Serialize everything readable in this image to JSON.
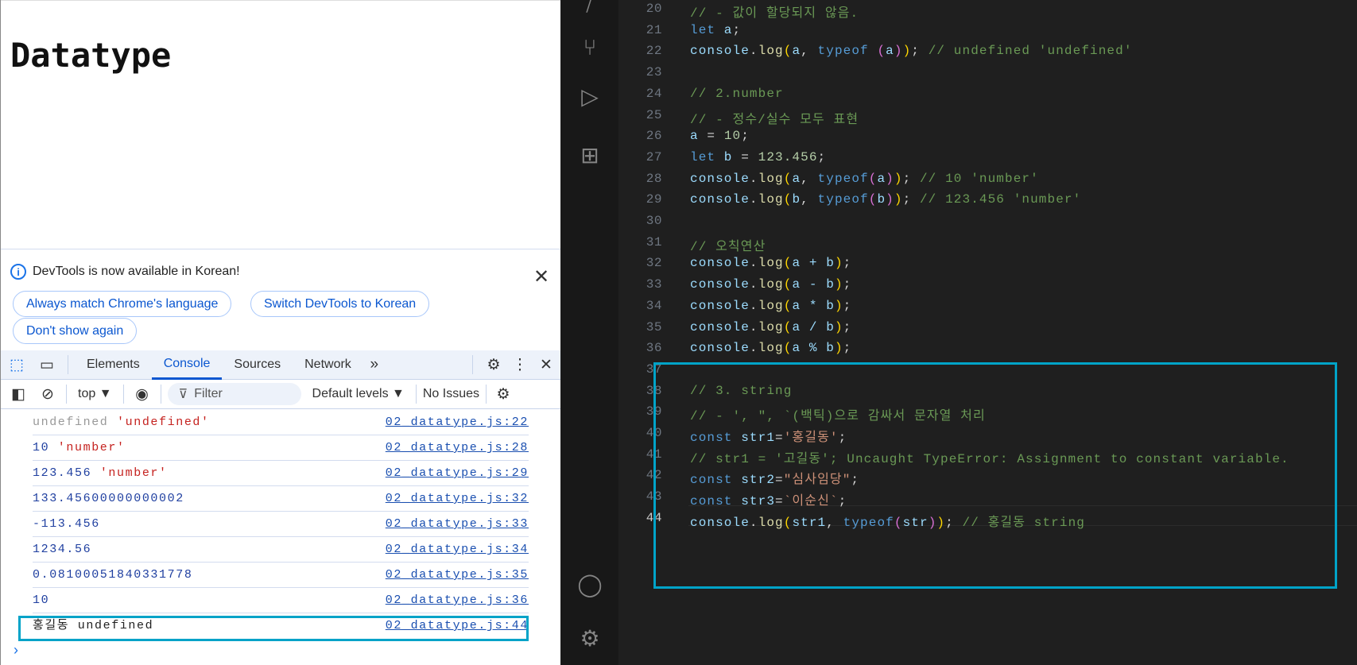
{
  "page": {
    "heading": "Datatype"
  },
  "infobar": {
    "message": "DevTools is now available in Korean!",
    "buttons": [
      "Always match Chrome's language",
      "Switch DevTools to Korean",
      "Don't show again"
    ]
  },
  "devtools": {
    "tabs": [
      "Elements",
      "Console",
      "Sources",
      "Network"
    ],
    "active_tab": "Console",
    "more": "»",
    "toolbar": {
      "context": "top ▼",
      "filter_placeholder": "Filter",
      "levels": "Default levels ▼",
      "issues": "No Issues"
    }
  },
  "console": [
    {
      "parts": [
        [
          "undefined",
          "gray"
        ],
        [
          " 'undefined'",
          "red"
        ]
      ],
      "source": "02_datatype.js:22"
    },
    {
      "parts": [
        [
          "10",
          ""
        ],
        [
          " 'number'",
          "red"
        ]
      ],
      "source": "02_datatype.js:28"
    },
    {
      "parts": [
        [
          "123.456",
          ""
        ],
        [
          " 'number'",
          "red"
        ]
      ],
      "source": "02_datatype.js:29"
    },
    {
      "parts": [
        [
          "133.45600000000002",
          ""
        ]
      ],
      "source": "02_datatype.js:32"
    },
    {
      "parts": [
        [
          "-113.456",
          ""
        ]
      ],
      "source": "02_datatype.js:33"
    },
    {
      "parts": [
        [
          "1234.56",
          ""
        ]
      ],
      "source": "02_datatype.js:34"
    },
    {
      "parts": [
        [
          "0.08100051840331778",
          ""
        ]
      ],
      "source": "02_datatype.js:35"
    },
    {
      "parts": [
        [
          "10",
          ""
        ]
      ],
      "source": "02_datatype.js:36"
    },
    {
      "parts": [
        [
          "홍길동 undefined",
          "dark"
        ]
      ],
      "source": "02_datatype.js:44",
      "highlighted": true
    }
  ],
  "console_prompt": "›",
  "highlight_color": "#00a3c8",
  "editor": {
    "current_line": 44,
    "lines": [
      {
        "n": 20,
        "t": [
          [
            "// - 값이 할당되지 않음.",
            "cm"
          ]
        ]
      },
      {
        "n": 21,
        "t": [
          [
            "let",
            "kw"
          ],
          [
            " a",
            ""
          ],
          [
            ";",
            "pl"
          ]
        ]
      },
      {
        "n": 22,
        "t": [
          [
            "console",
            "vr"
          ],
          [
            ".",
            "pl"
          ],
          [
            "log",
            "fn"
          ],
          [
            "(",
            "p1"
          ],
          [
            "a",
            "vr"
          ],
          [
            ", ",
            "pl"
          ],
          [
            "typeof",
            "kw"
          ],
          [
            " ",
            "pl"
          ],
          [
            "(",
            "p2"
          ],
          [
            "a",
            "vr"
          ],
          [
            ")",
            "p2"
          ],
          [
            ")",
            "p1"
          ],
          [
            "; ",
            "pl"
          ],
          [
            "// undefined 'undefined'",
            "cm"
          ]
        ]
      },
      {
        "n": 23,
        "t": []
      },
      {
        "n": 24,
        "t": [
          [
            "// 2.number",
            "cm"
          ]
        ]
      },
      {
        "n": 25,
        "t": [
          [
            "// - 정수/실수 모두 표현",
            "cm"
          ]
        ]
      },
      {
        "n": 26,
        "t": [
          [
            "a",
            "vr"
          ],
          [
            " = ",
            "pl"
          ],
          [
            "10",
            "nm"
          ],
          [
            ";",
            "pl"
          ]
        ]
      },
      {
        "n": 27,
        "t": [
          [
            "let",
            "kw"
          ],
          [
            " b",
            "vr"
          ],
          [
            " = ",
            "pl"
          ],
          [
            "123.456",
            "nm"
          ],
          [
            ";",
            "pl"
          ]
        ]
      },
      {
        "n": 28,
        "t": [
          [
            "console",
            "vr"
          ],
          [
            ".",
            "pl"
          ],
          [
            "log",
            "fn"
          ],
          [
            "(",
            "p1"
          ],
          [
            "a",
            "vr"
          ],
          [
            ", ",
            "pl"
          ],
          [
            "typeof",
            "kw"
          ],
          [
            "(",
            "p2"
          ],
          [
            "a",
            "vr"
          ],
          [
            ")",
            "p2"
          ],
          [
            ")",
            "p1"
          ],
          [
            "; ",
            "pl"
          ],
          [
            "// 10 'number'",
            "cm"
          ]
        ]
      },
      {
        "n": 29,
        "t": [
          [
            "console",
            "vr"
          ],
          [
            ".",
            "pl"
          ],
          [
            "log",
            "fn"
          ],
          [
            "(",
            "p1"
          ],
          [
            "b",
            "vr"
          ],
          [
            ", ",
            "pl"
          ],
          [
            "typeof",
            "kw"
          ],
          [
            "(",
            "p2"
          ],
          [
            "b",
            "vr"
          ],
          [
            ")",
            "p2"
          ],
          [
            ")",
            "p1"
          ],
          [
            "; ",
            "pl"
          ],
          [
            "// 123.456 'number'",
            "cm"
          ]
        ]
      },
      {
        "n": 30,
        "t": []
      },
      {
        "n": 31,
        "t": [
          [
            "// 오칙연산",
            "cm"
          ]
        ]
      },
      {
        "n": 32,
        "t": [
          [
            "console",
            "vr"
          ],
          [
            ".",
            "pl"
          ],
          [
            "log",
            "fn"
          ],
          [
            "(",
            "p1"
          ],
          [
            "a + b",
            "vr"
          ],
          [
            ")",
            "p1"
          ],
          [
            ";",
            "pl"
          ]
        ]
      },
      {
        "n": 33,
        "t": [
          [
            "console",
            "vr"
          ],
          [
            ".",
            "pl"
          ],
          [
            "log",
            "fn"
          ],
          [
            "(",
            "p1"
          ],
          [
            "a - b",
            "vr"
          ],
          [
            ")",
            "p1"
          ],
          [
            ";",
            "pl"
          ]
        ]
      },
      {
        "n": 34,
        "t": [
          [
            "console",
            "vr"
          ],
          [
            ".",
            "pl"
          ],
          [
            "log",
            "fn"
          ],
          [
            "(",
            "p1"
          ],
          [
            "a * b",
            "vr"
          ],
          [
            ")",
            "p1"
          ],
          [
            ";",
            "pl"
          ]
        ]
      },
      {
        "n": 35,
        "t": [
          [
            "console",
            "vr"
          ],
          [
            ".",
            "pl"
          ],
          [
            "log",
            "fn"
          ],
          [
            "(",
            "p1"
          ],
          [
            "a / b",
            "vr"
          ],
          [
            ")",
            "p1"
          ],
          [
            ";",
            "pl"
          ]
        ]
      },
      {
        "n": 36,
        "t": [
          [
            "console",
            "vr"
          ],
          [
            ".",
            "pl"
          ],
          [
            "log",
            "fn"
          ],
          [
            "(",
            "p1"
          ],
          [
            "a % b",
            "vr"
          ],
          [
            ")",
            "p1"
          ],
          [
            ";",
            "pl"
          ]
        ]
      },
      {
        "n": 37,
        "t": []
      },
      {
        "n": 38,
        "t": [
          [
            "// 3. string",
            "cm"
          ]
        ]
      },
      {
        "n": 39,
        "t": [
          [
            "// - ', \", `(백틱)으로 감싸서 문자열 처리",
            "cm"
          ]
        ]
      },
      {
        "n": 40,
        "t": [
          [
            "const",
            "kw"
          ],
          [
            " str1",
            "vr"
          ],
          [
            "=",
            "pl"
          ],
          [
            "'홍길동'",
            "st"
          ],
          [
            ";",
            "pl"
          ]
        ]
      },
      {
        "n": 41,
        "t": [
          [
            "// str1 = '고길동'; Uncaught TypeError: Assignment to constant variable.",
            "cm"
          ]
        ]
      },
      {
        "n": 42,
        "t": [
          [
            "const",
            "kw"
          ],
          [
            " str2",
            "vr"
          ],
          [
            "=",
            "pl"
          ],
          [
            "\"심사임당\"",
            "st"
          ],
          [
            ";",
            "pl"
          ]
        ]
      },
      {
        "n": 43,
        "t": [
          [
            "const",
            "kw"
          ],
          [
            " str3",
            "vr"
          ],
          [
            "=",
            "pl"
          ],
          [
            "`이순신`",
            "st"
          ],
          [
            ";",
            "pl"
          ]
        ]
      },
      {
        "n": 44,
        "t": [
          [
            "console",
            "vr"
          ],
          [
            ".",
            "pl"
          ],
          [
            "log",
            "fn"
          ],
          [
            "(",
            "p1"
          ],
          [
            "str1",
            "vr"
          ],
          [
            ", ",
            "pl"
          ],
          [
            "typeof",
            "kw"
          ],
          [
            "(",
            "p2"
          ],
          [
            "str",
            "vr"
          ],
          [
            ")",
            "p2"
          ],
          [
            ")",
            "p1"
          ],
          [
            "; ",
            "pl"
          ],
          [
            "// 홍길동 string",
            "cm"
          ]
        ]
      }
    ]
  }
}
